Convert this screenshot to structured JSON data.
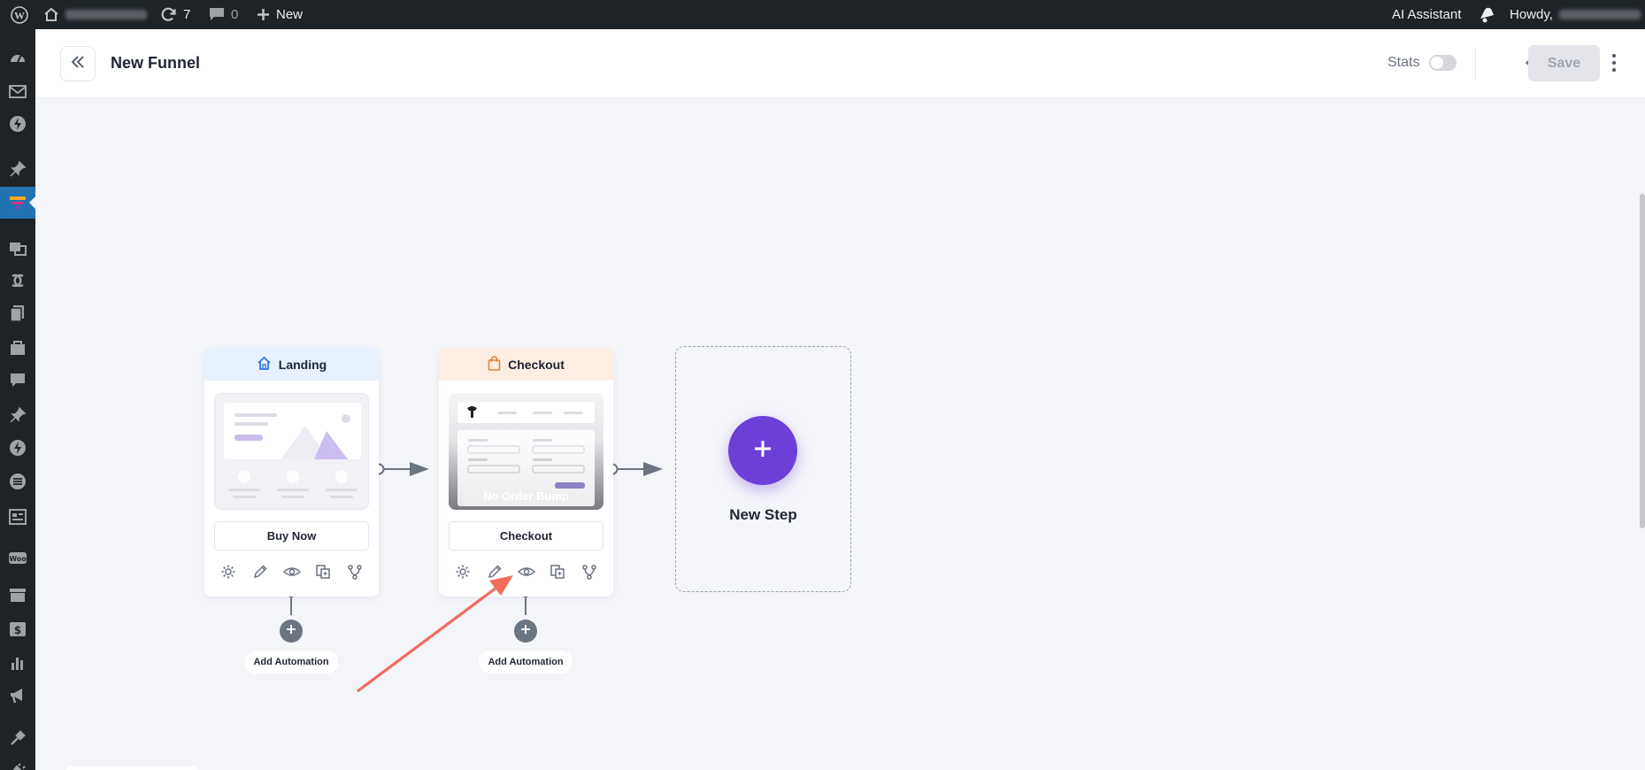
{
  "admin_bar": {
    "updates_count": "7",
    "comments_count": "0",
    "new_label": "New",
    "ai_assistant_label": "AI Assistant",
    "howdy_label": "Howdy,"
  },
  "header": {
    "title": "New Funnel",
    "stats_label": "Stats",
    "stats_enabled": false,
    "save_label": "Save"
  },
  "steps": [
    {
      "label": "Landing",
      "button_label": "Buy Now",
      "header_color": "#e6f1fd",
      "icon": "home-icon",
      "automation_label": "Add Automation"
    },
    {
      "label": "Checkout",
      "button_label": "Checkout",
      "header_color": "#fdeee3",
      "icon": "shopping-bag-icon",
      "thumb_overlay": "No Order Bump",
      "automation_label": "Add Automation"
    }
  ],
  "new_step": {
    "label": "New Step",
    "accent_color": "#6d3fd9"
  },
  "step_actions": [
    "gear-icon",
    "pencil-icon",
    "eye-icon",
    "duplicate-icon",
    "branch-icon"
  ],
  "annotation": {
    "arrow_color": "#f26b5b"
  }
}
